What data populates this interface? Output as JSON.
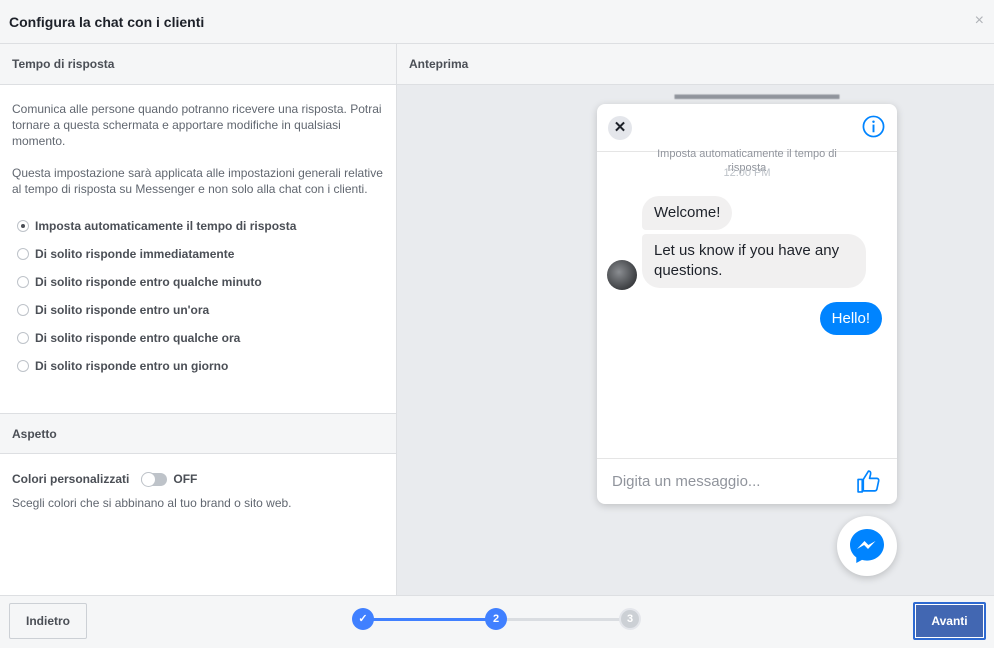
{
  "header": {
    "title": "Configura la chat con i clienti",
    "close": "×"
  },
  "left": {
    "section_title": "Tempo di risposta",
    "desc1": "Comunica alle persone quando potranno ricevere una risposta. Potrai tornare a questa schermata e apportare modifiche in qualsiasi momento.",
    "desc2": "Questa impostazione sarà applicata alle impostazioni generali relative al tempo di risposta su Messenger e non solo alla chat con i clienti.",
    "options": [
      {
        "label": "Imposta automaticamente il tempo di risposta",
        "selected": true
      },
      {
        "label": "Di solito risponde immediatamente",
        "selected": false
      },
      {
        "label": "Di solito risponde entro qualche minuto",
        "selected": false
      },
      {
        "label": "Di solito risponde entro un'ora",
        "selected": false
      },
      {
        "label": "Di solito risponde entro qualche ora",
        "selected": false
      },
      {
        "label": "Di solito risponde entro un giorno",
        "selected": false
      }
    ],
    "aspetto_title": "Aspetto",
    "colori_label": "Colori personalizzati",
    "toggle_state": "OFF",
    "colori_sub": "Scegli colori che si abbinano al tuo brand o sito web."
  },
  "preview": {
    "section_title": "Anteprima",
    "auto_note": "Imposta automaticamente il tempo di risposta",
    "time": "12:00 PM",
    "messages": {
      "welcome": "Welcome!",
      "question": "Let us know if you have any questions.",
      "reply": "Hello!"
    },
    "composer_placeholder": "Digita un messaggio..."
  },
  "footer": {
    "back_label": "Indietro",
    "next_label": "Avanti",
    "steps": [
      {
        "label": "✓",
        "state": "done"
      },
      {
        "label": "2",
        "state": "current"
      },
      {
        "label": "3",
        "state": "todo"
      }
    ]
  },
  "colors": {
    "accent": "#4080ff",
    "messenger_blue": "#0084ff",
    "primary_button": "#4267b2"
  }
}
